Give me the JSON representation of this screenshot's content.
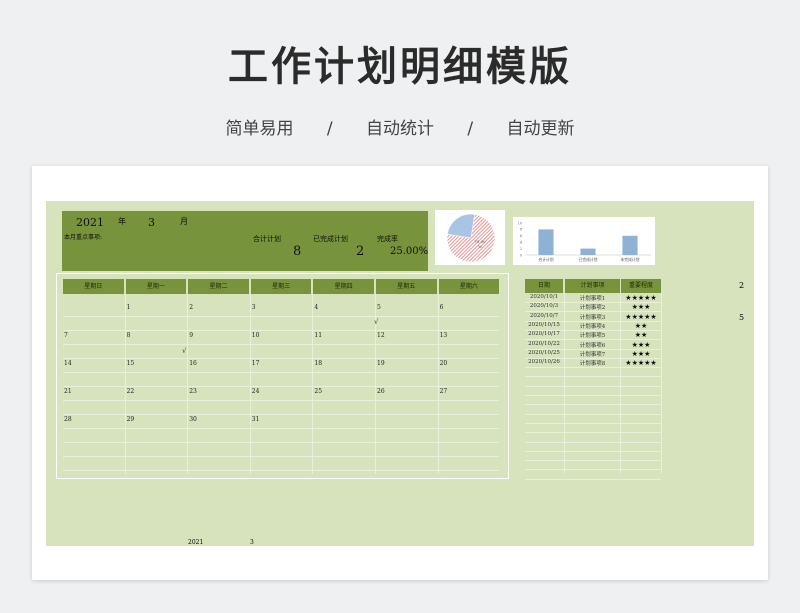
{
  "header": {
    "title": "工作计划明细模版",
    "tags": [
      "简单易用",
      "自动统计",
      "自动更新"
    ],
    "sep": "/"
  },
  "banner": {
    "year": "2021",
    "year_unit": "年",
    "month": "3",
    "month_unit": "月",
    "note_label": "本月重点事项:",
    "total_label": "合计计划",
    "total_value": "8",
    "done_label": "已完成计划",
    "done_value": "2",
    "rate_label": "完成率",
    "rate_value": "25.00%"
  },
  "chart_data": [
    {
      "type": "pie",
      "values": [
        25,
        75
      ],
      "labels": [
        "",
        "75.00\n%"
      ],
      "colors": [
        "#a9c4e4",
        "#e78a8a"
      ]
    },
    {
      "type": "bar",
      "categories": [
        "合计计划",
        "已完成计划",
        "未完成计划"
      ],
      "values": [
        8,
        2,
        6
      ],
      "ylim": [
        0,
        10
      ],
      "yticks": [
        "0",
        "2",
        "4",
        "6",
        "8",
        "10"
      ],
      "color": "#8fb1d6"
    }
  ],
  "calendar": {
    "weekdays": [
      "星期日",
      "星期一",
      "星期二",
      "星期三",
      "星期四",
      "星期五",
      "星期六"
    ],
    "weeks": [
      [
        "",
        "1",
        "2",
        "3",
        "4",
        "5",
        "6"
      ],
      [
        "7",
        "8",
        "9",
        "10",
        "11",
        "12",
        "13"
      ],
      [
        "14",
        "15",
        "16",
        "17",
        "18",
        "19",
        "20"
      ],
      [
        "21",
        "22",
        "23",
        "24",
        "25",
        "26",
        "27"
      ],
      [
        "28",
        "29",
        "30",
        "31",
        "",
        "",
        ""
      ]
    ],
    "checks": [
      "√",
      "√"
    ],
    "footer_year": "2021",
    "footer_month": "3"
  },
  "plan_table": {
    "headers": [
      "日期",
      "计划事项",
      "重要程度"
    ],
    "rows": [
      [
        "2020/10/1",
        "计划事项1",
        "★★★★★"
      ],
      [
        "2020/10/3",
        "计划事项2",
        "★★★"
      ],
      [
        "2020/10/7",
        "计划事项3",
        "★★★★★"
      ],
      [
        "2020/10/15",
        "计划事项4",
        "★★"
      ],
      [
        "2020/10/17",
        "计划事项5",
        "★★"
      ],
      [
        "2020/10/22",
        "计划事项6",
        "★★★"
      ],
      [
        "2020/10/25",
        "计划事项7",
        "★★★"
      ],
      [
        "2020/10/26",
        "计划事项8",
        "★★★★★"
      ]
    ],
    "side_values": [
      "2",
      "5"
    ]
  }
}
